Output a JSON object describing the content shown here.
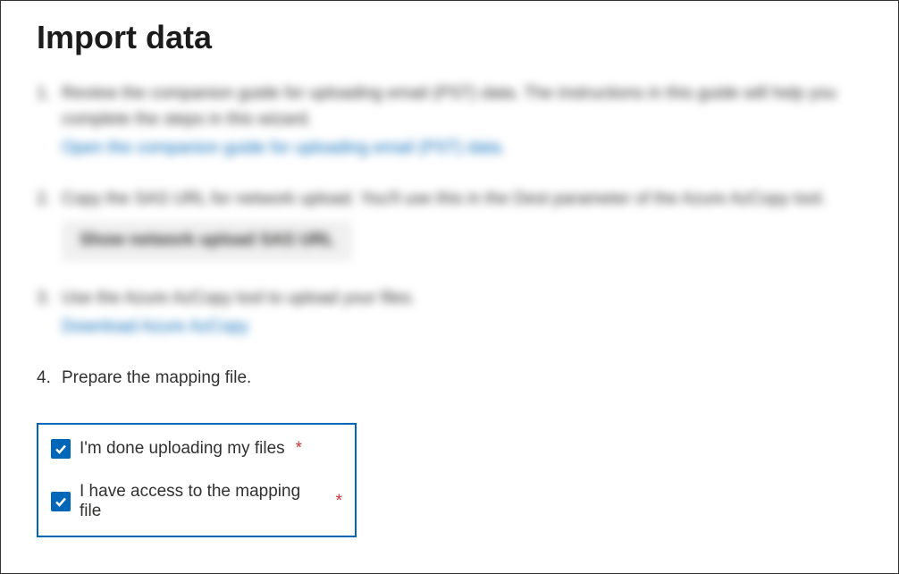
{
  "page": {
    "title": "Import data"
  },
  "steps": {
    "1": {
      "text": "Review the companion guide for uploading email (PST) data. The instructions in this guide will help you complete the steps in this wizard.",
      "link": "Open the companion guide for uploading email (PST) data."
    },
    "2": {
      "text": "Copy the SAS URL for network upload. You'll use this in the Dest parameter of the Azure AzCopy tool.",
      "button": "Show network upload SAS URL"
    },
    "3": {
      "text": "Use the Azure AzCopy tool to upload your files.",
      "link": "Download Azure AzCopy"
    },
    "4": {
      "text": "Prepare the mapping file."
    }
  },
  "checkboxes": {
    "done_uploading": {
      "label": "I'm done uploading my files",
      "required": "*",
      "checked": true
    },
    "access_mapping": {
      "label": "I have access to the mapping file",
      "required": "*",
      "checked": true
    }
  }
}
